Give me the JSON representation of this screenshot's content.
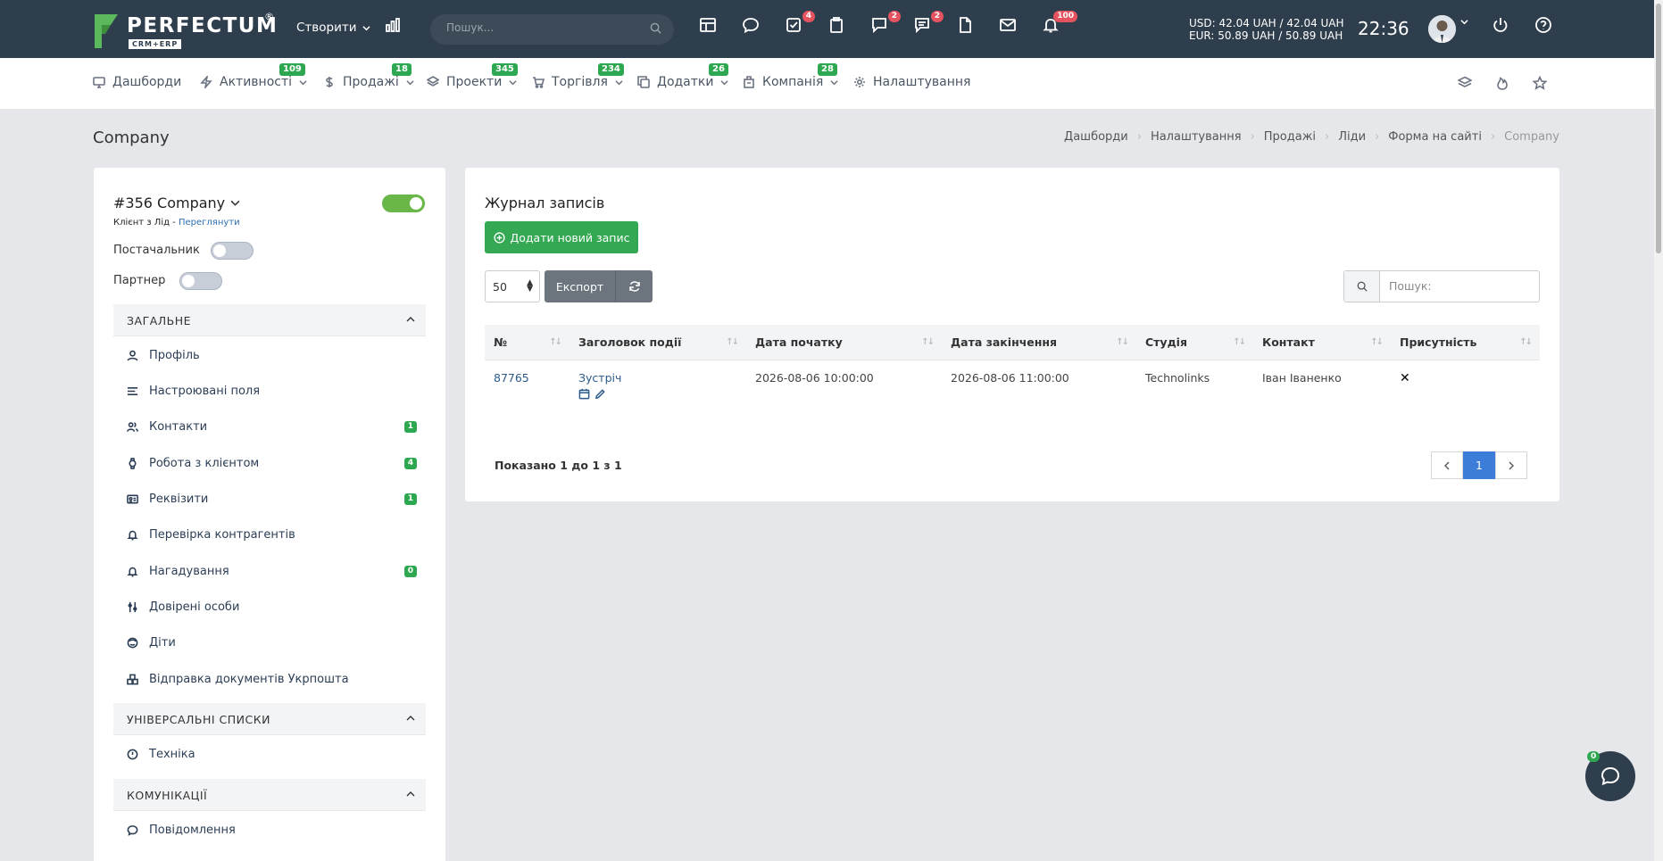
{
  "app": {
    "logo_text": "PERFECTUM",
    "logo_sub": "CRM+ERP",
    "logo_reg": "®"
  },
  "topbar": {
    "create_label": "Створити",
    "search_placeholder": "Пошук...",
    "badges": {
      "tasks": "4",
      "chat": "2",
      "messages": "2",
      "notifications": "100"
    },
    "currency_usd": "USD: 42.04 UAH / 42.04 UAH",
    "currency_eur": "EUR: 50.89 UAH / 50.89 UAH",
    "clock": "22:36"
  },
  "nav": {
    "items": [
      {
        "label": "Дашборди",
        "icon": "monitor-icon",
        "badge": ""
      },
      {
        "label": "Активності",
        "icon": "bolt-icon",
        "badge": "109"
      },
      {
        "label": "Продажі",
        "icon": "dollar-icon",
        "badge": "18"
      },
      {
        "label": "Проекти",
        "icon": "layers-icon",
        "badge": "345"
      },
      {
        "label": "Торгівля",
        "icon": "cart-icon",
        "badge": "234"
      },
      {
        "label": "Додатки",
        "icon": "copy-icon",
        "badge": "26"
      },
      {
        "label": "Компанія",
        "icon": "building-icon",
        "badge": "28"
      },
      {
        "label": "Налаштування",
        "icon": "gear-icon",
        "badge": ""
      }
    ]
  },
  "page": {
    "title": "Company",
    "breadcrumb": [
      "Дашборди",
      "Налаштування",
      "Продажі",
      "Ліди",
      "Форма на сайті",
      "Company"
    ]
  },
  "left": {
    "company_name": "#356 Company",
    "company_sub": "Клієнт з Лід - ",
    "company_sub_link": "Переглянути",
    "supplier_label": "Постачальник",
    "partner_label": "Партнер",
    "sections": {
      "general": "ЗАГАЛЬНЕ",
      "universal": "УНІВЕРСАЛЬНІ СПИСКИ",
      "communications": "КОМУНІКАЦІЇ"
    },
    "general_items": [
      {
        "label": "Профіль",
        "count": ""
      },
      {
        "label": "Настроювані поля",
        "count": ""
      },
      {
        "label": "Контакти",
        "count": "1"
      },
      {
        "label": "Робота з клієнтом",
        "count": "4"
      },
      {
        "label": "Реквізити",
        "count": "1"
      },
      {
        "label": "Перевірка контрагентів",
        "count": ""
      },
      {
        "label": "Нагадування",
        "count": "0"
      },
      {
        "label": "Довірені особи",
        "count": ""
      },
      {
        "label": "Діти",
        "count": ""
      },
      {
        "label": "Відправка документів Укрпошта",
        "count": ""
      }
    ],
    "universal_items": [
      {
        "label": "Техніка"
      }
    ],
    "comm_items": [
      {
        "label": "Повідомлення"
      }
    ]
  },
  "main": {
    "title": "Журнал записів",
    "add_button": "Додати новий запис",
    "per_page": "50",
    "export_label": "Експорт",
    "search_placeholder": "Пошук:",
    "columns": [
      "№",
      "Заголовок події",
      "Дата початку",
      "Дата закінчення",
      "Студія",
      "Контакт",
      "Присутність"
    ],
    "rows": [
      {
        "id": "87765",
        "title": "Зустріч",
        "start": "2026-08-06 10:00:00",
        "end": "2026-08-06 11:00:00",
        "studio": "Technolinks",
        "contact": "Іван Іваненко",
        "presence": "✕"
      }
    ],
    "shown_text": "Показано 1 до 1 з 1",
    "page_current": "1"
  },
  "chat": {
    "badge": "0"
  },
  "colors": {
    "topbar": "#2f3e4d",
    "accent_green": "#34a853",
    "badge_red": "#e5535f",
    "pager_active": "#3b7dd8"
  }
}
